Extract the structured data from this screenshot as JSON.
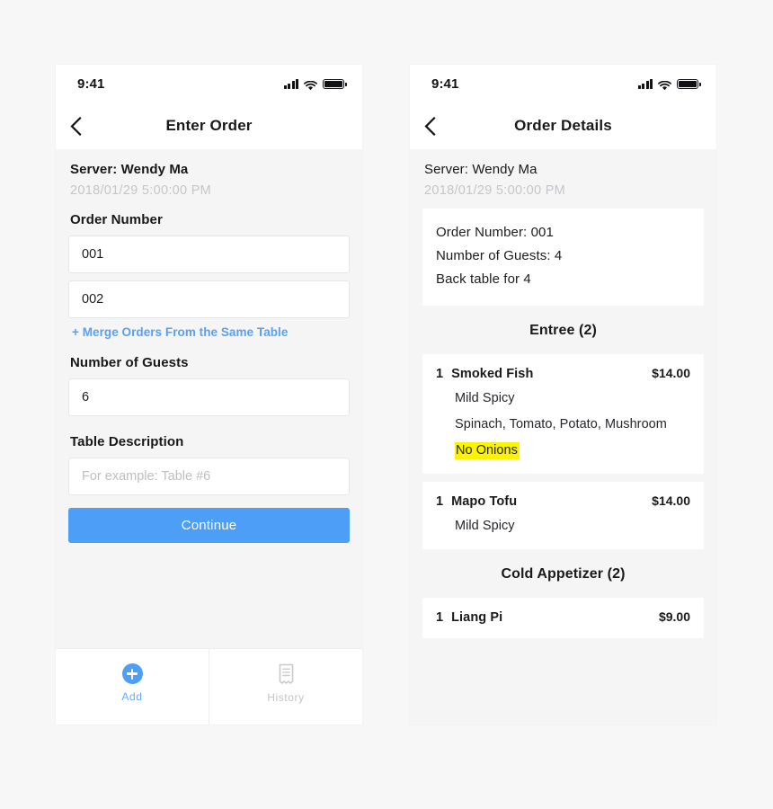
{
  "status_bar": {
    "time": "9:41",
    "signal_icon": "cellular-signal-icon",
    "wifi_icon": "wifi-icon",
    "battery_icon": "battery-full-icon"
  },
  "left_phone": {
    "nav": {
      "back_icon": "chevron-left-icon",
      "title": "Enter Order"
    },
    "server": {
      "name": "Server: Wendy Ma",
      "datetime": "2018/01/29  5:00:00 PM"
    },
    "form": {
      "order_number_label": "Order Number",
      "order_number_1": "001",
      "order_number_2": "002",
      "merge_link": "+ Merge Orders From the Same Table",
      "guests_label": "Number of Guests",
      "guests_value": "6",
      "table_label": "Table Description",
      "table_placeholder": "For example: Table #6",
      "continue_label": "Continue"
    },
    "tab_bar": {
      "items": [
        {
          "label": "Add",
          "icon": "plus-circle-icon",
          "active": true
        },
        {
          "label": "History",
          "icon": "receipt-icon",
          "active": false
        }
      ]
    }
  },
  "right_phone": {
    "nav": {
      "back_icon": "chevron-left-icon",
      "title": "Order Details"
    },
    "server": {
      "name": "Server: Wendy Ma",
      "datetime": "2018/01/29  5:00:00 PM"
    },
    "summary": {
      "order_number": "Order Number: 001",
      "guests": "Number of Guests: 4",
      "table": "Back table for 4"
    },
    "sections": [
      {
        "header": "Entree (2)",
        "items": [
          {
            "qty": "1",
            "name": "Smoked Fish",
            "price": "$14.00",
            "options": [
              {
                "text": "Mild Spicy",
                "highlight": false
              },
              {
                "text": "Spinach, Tomato, Potato, Mushroom",
                "highlight": false
              },
              {
                "text": "No Onions",
                "highlight": true
              }
            ]
          },
          {
            "qty": "1",
            "name": "Mapo Tofu",
            "price": "$14.00",
            "options": [
              {
                "text": "Mild Spicy",
                "highlight": false
              }
            ]
          }
        ]
      },
      {
        "header": "Cold Appetizer (2)",
        "items": [
          {
            "qty": "1",
            "name": "Liang Pi",
            "price": "$9.00",
            "options": []
          }
        ]
      }
    ]
  },
  "colors": {
    "accent_blue": "#4d9ef7",
    "link_blue": "#57a0f6",
    "highlight_yellow": "#fcf300",
    "page_bg": "#f7f7f8",
    "screen_bg": "#f5f5f6"
  }
}
